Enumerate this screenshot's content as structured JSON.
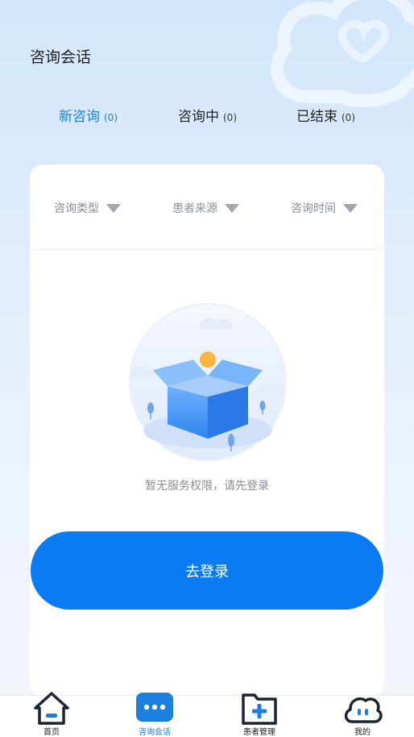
{
  "header": {
    "title": "咨询会话"
  },
  "tabs": [
    {
      "label": "新咨询",
      "count": "(0)",
      "active": true
    },
    {
      "label": "咨询中",
      "count": "(0)",
      "active": false
    },
    {
      "label": "已结束",
      "count": "(0)",
      "active": false
    }
  ],
  "filters": [
    {
      "label": "咨询类型",
      "icon": "triangle-down-icon"
    },
    {
      "label": "患者来源",
      "icon": "triangle-down-icon"
    },
    {
      "label": "咨询时间",
      "icon": "triangle-down-icon"
    }
  ],
  "empty_state": {
    "illustration": "empty-box-icon",
    "message": "暂无服务权限，请先登录"
  },
  "login_button": {
    "label": "去登录"
  },
  "bottom_nav": [
    {
      "label": "首页",
      "icon": "home-icon",
      "active": false
    },
    {
      "label": "咨询会话",
      "icon": "chat-icon",
      "active": true
    },
    {
      "label": "患者管理",
      "icon": "folder-plus-icon",
      "active": false
    },
    {
      "label": "我的",
      "icon": "cloud-face-icon",
      "active": false
    }
  ],
  "colors": {
    "accent": "#1a7fde",
    "button": "#0a7bf3",
    "nav_dark": "#1c2430"
  }
}
